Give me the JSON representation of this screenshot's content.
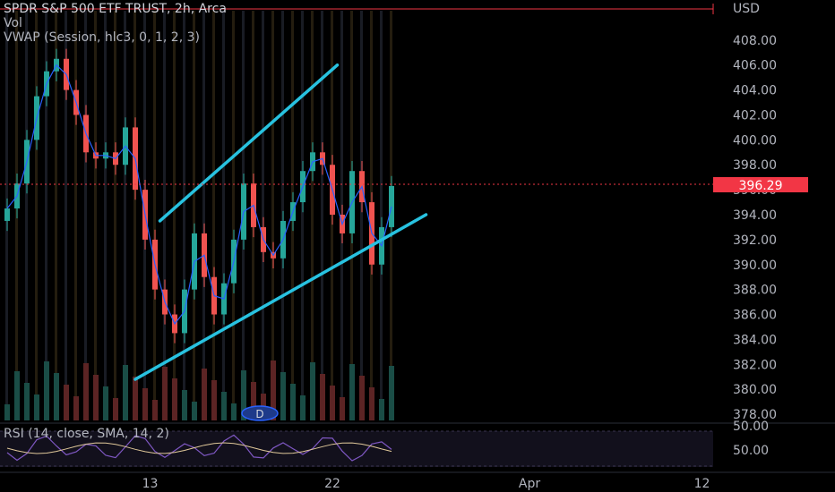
{
  "legend": {
    "title": "SPDR S&P 500 ETF TRUST, 2h, Arca",
    "vol": "Vol",
    "vwap": "VWAP (Session, hlc3, 0, 1, 2, 3)"
  },
  "rsi_legend": "RSI (14, close, SMA, 14, 2)",
  "currency": "USD",
  "current_price": "396.29",
  "dividend_marker": "D",
  "colors": {
    "background": "#000000",
    "up": "#26a69a",
    "down": "#ef5350",
    "vwap": "#2962ff",
    "trendline": "#28c2e0",
    "rsi": "#7e57c2",
    "price_line": "#f23645"
  },
  "chart_data": {
    "type": "candlestick",
    "symbol": "SPDR S&P 500 ETF TRUST",
    "interval": "2h",
    "exchange": "Arca",
    "y_axis": {
      "ticks": [
        "378.00",
        "380.00",
        "382.00",
        "384.00",
        "386.00",
        "388.00",
        "390.00",
        "392.00",
        "394.00",
        "396.00",
        "398.00",
        "400.00",
        "402.00",
        "404.00",
        "406.00",
        "408.00"
      ],
      "range": [
        377.5,
        410.5
      ]
    },
    "x_axis": {
      "ticks": [
        "13",
        "22",
        "Apr",
        "12"
      ]
    },
    "price_series": [
      {
        "x": 0,
        "close": 394.5
      },
      {
        "x": 1,
        "close": 396.5
      },
      {
        "x": 2,
        "close": 400.0
      },
      {
        "x": 3,
        "close": 403.5
      },
      {
        "x": 4,
        "close": 405.5
      },
      {
        "x": 5,
        "close": 406.5
      },
      {
        "x": 6,
        "close": 404.0
      },
      {
        "x": 7,
        "close": 402.0
      },
      {
        "x": 8,
        "close": 399.0
      },
      {
        "x": 9,
        "close": 398.5
      },
      {
        "x": 10,
        "close": 399.0
      },
      {
        "x": 11,
        "close": 398.0
      },
      {
        "x": 12,
        "close": 401.0
      },
      {
        "x": 13,
        "close": 396.0
      },
      {
        "x": 14,
        "close": 392.0
      },
      {
        "x": 15,
        "close": 388.0
      },
      {
        "x": 16,
        "close": 386.0
      },
      {
        "x": 17,
        "close": 384.5
      },
      {
        "x": 18,
        "close": 388.0
      },
      {
        "x": 19,
        "close": 392.5
      },
      {
        "x": 20,
        "close": 389.0
      },
      {
        "x": 21,
        "close": 386.0
      },
      {
        "x": 22,
        "close": 388.5
      },
      {
        "x": 23,
        "close": 392.0
      },
      {
        "x": 24,
        "close": 396.5
      },
      {
        "x": 25,
        "close": 393.0
      },
      {
        "x": 26,
        "close": 391.0
      },
      {
        "x": 27,
        "close": 390.5
      },
      {
        "x": 28,
        "close": 393.5
      },
      {
        "x": 29,
        "close": 395.0
      },
      {
        "x": 30,
        "close": 397.5
      },
      {
        "x": 31,
        "close": 399.0
      },
      {
        "x": 32,
        "close": 398.0
      },
      {
        "x": 33,
        "close": 394.0
      },
      {
        "x": 34,
        "close": 392.5
      },
      {
        "x": 35,
        "close": 397.5
      },
      {
        "x": 36,
        "close": 395.0
      },
      {
        "x": 37,
        "close": 390.0
      },
      {
        "x": 38,
        "close": 393.0
      },
      {
        "x": 39,
        "close": 396.3
      }
    ],
    "trendlines": [
      {
        "name": "upper channel",
        "from": {
          "x": 15.5,
          "y": 393.5
        },
        "to": {
          "x": 33.5,
          "y": 406.0
        }
      },
      {
        "name": "lower channel",
        "from": {
          "x": 13.0,
          "y": 380.8
        },
        "to": {
          "x": 42.5,
          "y": 394.0
        }
      }
    ],
    "rsi": {
      "visible_tick": "50.00"
    }
  }
}
